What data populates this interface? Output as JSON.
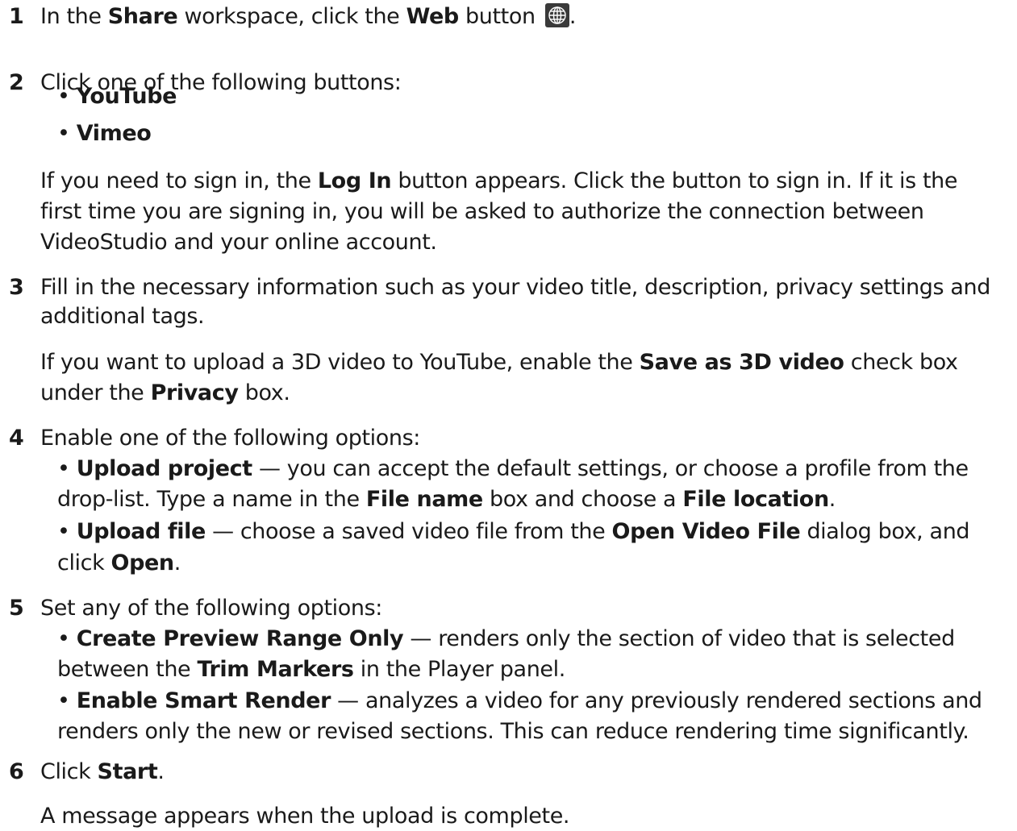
{
  "steps": [
    {
      "number": "1",
      "lines": [
        [
          {
            "t": "In the "
          },
          {
            "t": "Share",
            "b": 1
          },
          {
            "t": " workspace, click the "
          },
          {
            "t": "Web",
            "b": 1
          },
          {
            "t": " button "
          },
          {
            "icon": "globe-icon"
          },
          {
            "t": "."
          }
        ]
      ]
    },
    {
      "number": "2",
      "lines": [
        [
          {
            "t": "Click one of the following buttons:"
          }
        ]
      ]
    },
    {
      "number": "",
      "lines": [
        [
          {
            "t": "• "
          },
          {
            "t": "YouTube",
            "b": 1
          }
        ],
        [
          {
            "t": "• "
          },
          {
            "t": "Vimeo",
            "b": 1
          }
        ],
        [
          {
            "t": "If you need to sign in, the "
          },
          {
            "t": "Log In",
            "b": 1
          },
          {
            "t": " button appears. Click the button to sign in. If it is the"
          }
        ],
        [
          {
            "t": "first time you are signing in, you will be asked to authorize the connection between"
          }
        ],
        [
          {
            "t": "VideoStudio and your online account."
          }
        ]
      ]
    },
    {
      "number": "3",
      "lines": [
        [
          {
            "t": "Fill in the necessary information such as your video title, description, privacy settings and"
          }
        ],
        [
          {
            "t": "additional tags."
          }
        ],
        [
          {
            "t": "If you want to upload a 3D video to YouTube, enable the "
          },
          {
            "t": "Save as 3D video",
            "b": 1
          },
          {
            "t": " check box"
          }
        ],
        [
          {
            "t": "under the "
          },
          {
            "t": "Privacy",
            "b": 1
          },
          {
            "t": " box."
          }
        ]
      ]
    },
    {
      "number": "4",
      "lines": [
        [
          {
            "t": "Enable one of the following options:"
          }
        ],
        [
          {
            "t": "• "
          },
          {
            "t": "Upload project",
            "b": 1
          },
          {
            "t": " — you can accept the default settings, or choose a profile from the"
          }
        ],
        [
          {
            "t": "drop-list. Type a name in the "
          },
          {
            "t": "File name",
            "b": 1
          },
          {
            "t": " box and choose a "
          },
          {
            "t": "File location",
            "b": 1
          },
          {
            "t": "."
          }
        ],
        [
          {
            "t": "• "
          },
          {
            "t": "Upload file",
            "b": 1
          },
          {
            "t": " — choose a saved video file from the "
          },
          {
            "t": "Open Video File",
            "b": 1
          },
          {
            "t": " dialog box, and"
          }
        ],
        [
          {
            "t": "click "
          },
          {
            "t": "Open",
            "b": 1
          },
          {
            "t": "."
          }
        ]
      ]
    },
    {
      "number": "5",
      "lines": [
        [
          {
            "t": "Set any of the following options:"
          }
        ],
        [
          {
            "t": "• "
          },
          {
            "t": "Create Preview Range Only",
            "b": 1
          },
          {
            "t": " — renders only the section of video that is selected"
          }
        ],
        [
          {
            "t": "between the "
          },
          {
            "t": "Trim Markers",
            "b": 1
          },
          {
            "t": " in the Player panel."
          }
        ],
        [
          {
            "t": "• "
          },
          {
            "t": "Enable Smart Render",
            "b": 1
          },
          {
            "t": " — analyzes a video for any previously rendered sections and"
          }
        ],
        [
          {
            "t": "renders only the new or revised sections. This can reduce rendering time significantly."
          }
        ]
      ]
    },
    {
      "number": "6",
      "lines": [
        [
          {
            "t": "Click "
          },
          {
            "t": "Start",
            "b": 1
          },
          {
            "t": "."
          }
        ],
        [
          {
            "t": "A message appears when the upload is complete."
          }
        ]
      ]
    }
  ]
}
